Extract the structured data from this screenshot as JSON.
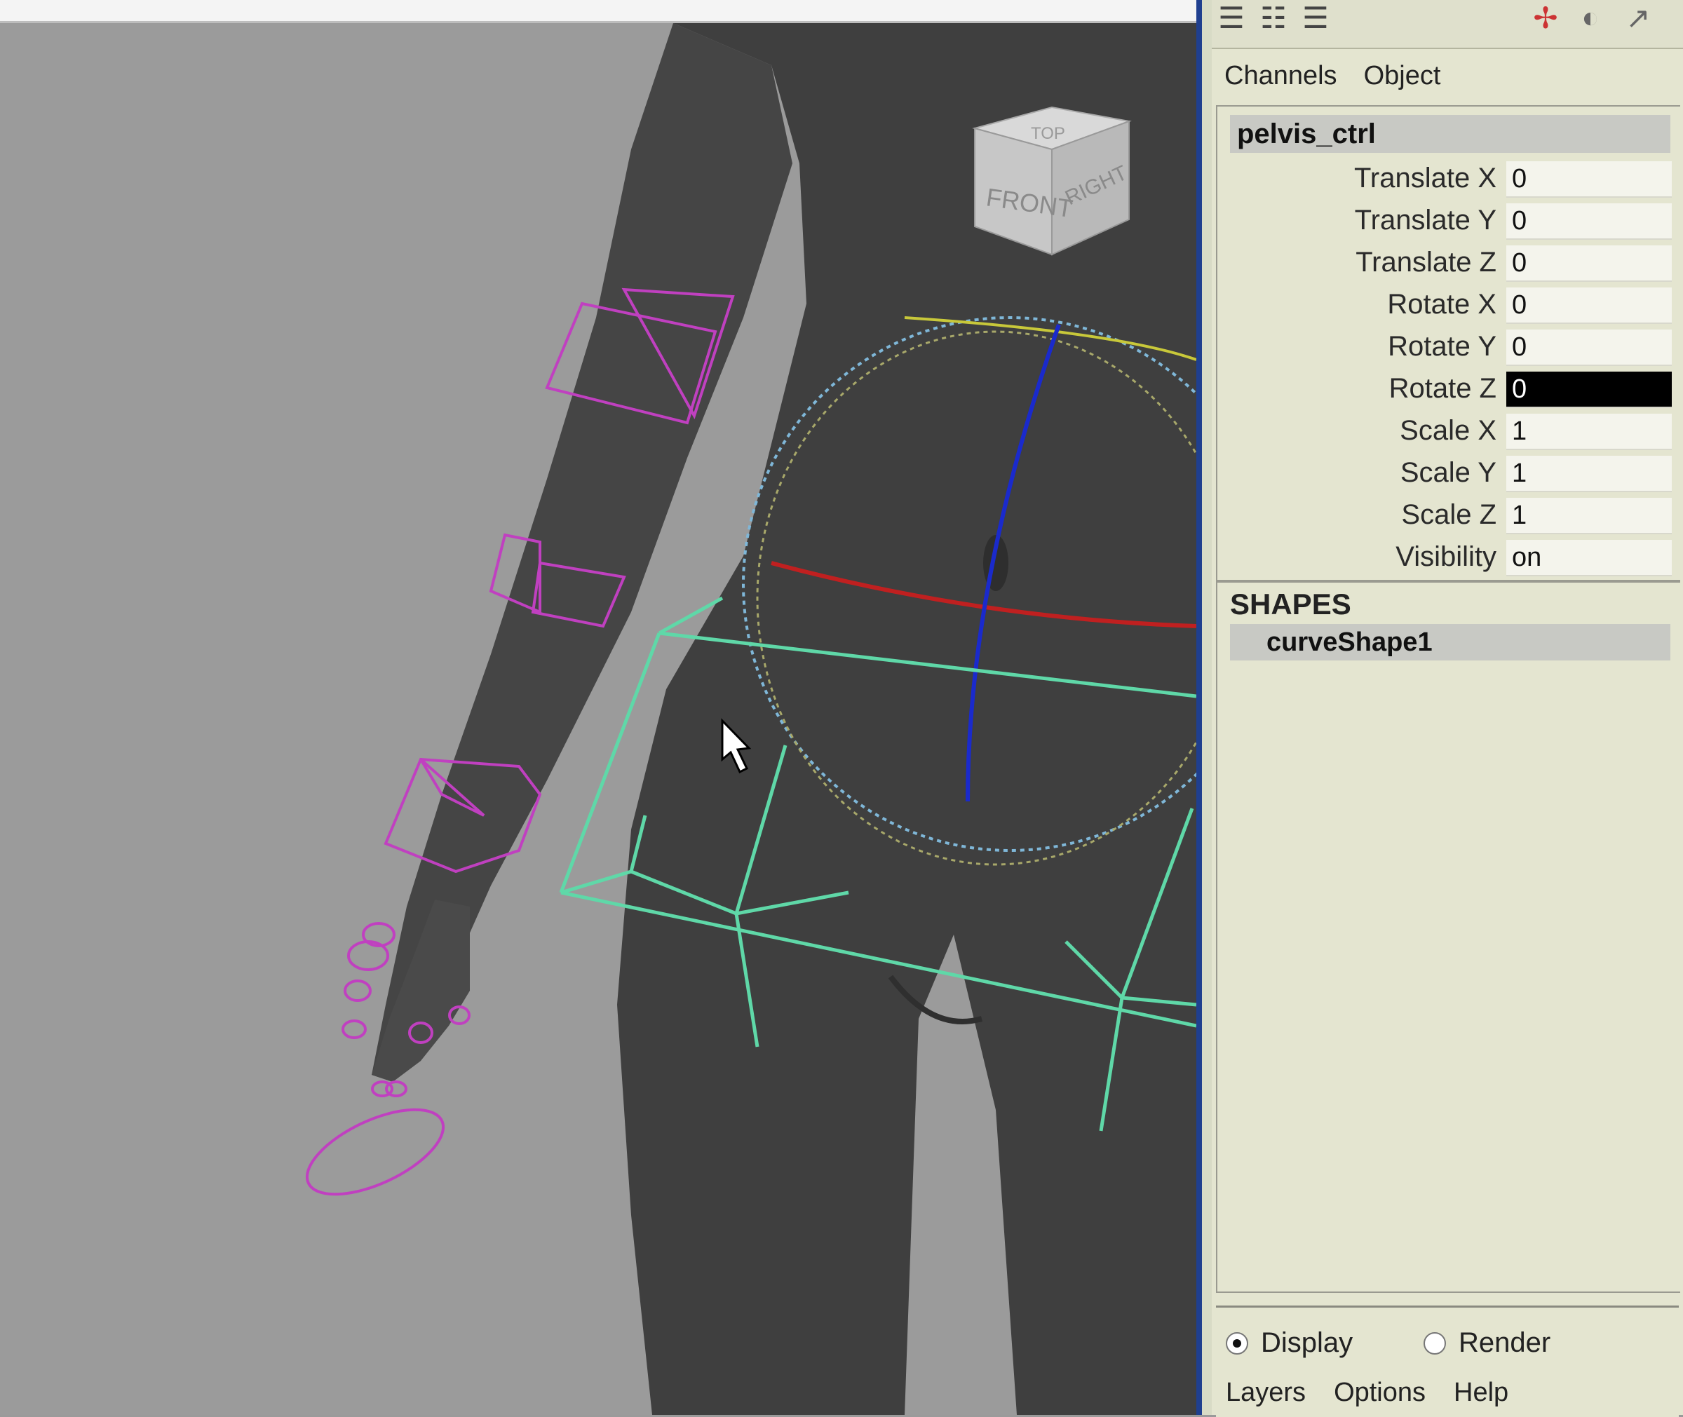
{
  "panel": {
    "toolbar_icons": [
      "channel-list-icon",
      "channel-list-icon",
      "channel-list-icon",
      "axis-icon",
      "sphere-icon",
      "arrow-icon"
    ],
    "menus": [
      "Channels",
      "Object"
    ],
    "object_name": "pelvis_ctrl",
    "attributes": [
      {
        "label": "Translate X",
        "value": "0"
      },
      {
        "label": "Translate Y",
        "value": "0"
      },
      {
        "label": "Translate Z",
        "value": "0"
      },
      {
        "label": "Rotate X",
        "value": "0"
      },
      {
        "label": "Rotate Y",
        "value": "0"
      },
      {
        "label": "Rotate Z",
        "value": "0"
      },
      {
        "label": "Scale X",
        "value": "1"
      },
      {
        "label": "Scale Y",
        "value": "1"
      },
      {
        "label": "Scale Z",
        "value": "1"
      },
      {
        "label": "Visibility",
        "value": "on"
      }
    ],
    "shapes_title": "SHAPES",
    "shape_name": "curveShape1",
    "layer": {
      "display_label": "Display",
      "render_label": "Render",
      "menus": [
        "Layers",
        "Options",
        "Help"
      ]
    }
  },
  "viewcube": {
    "front_label": "FRONT",
    "right_label": "RIGHT",
    "top_label": "TOP"
  },
  "colors": {
    "panel_bg": "#e4e5d0",
    "selected_value_bg": "#000000",
    "ik_control": "#c040c0",
    "fk_control": "#5fd8a8"
  }
}
